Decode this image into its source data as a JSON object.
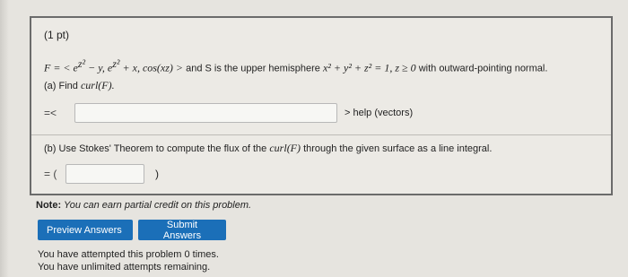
{
  "problem": {
    "points_label": "(1 pt)",
    "statement": {
      "lhs": "F = < e",
      "exp1": "z²",
      "mid1": " − y, e",
      "exp2": "z²",
      "mid2": " + x, cos(xz) >",
      "text": " and S is the upper hemisphere ",
      "eq": "x² + y² + z² = 1, z ≥ 0",
      "tail": " with outward-pointing normal."
    },
    "part_a": {
      "label": "(a) Find ",
      "math": "curl(F).",
      "prefix": "=<",
      "input_value": "",
      "help_link": "> help (vectors)"
    },
    "part_b": {
      "label": "(b) Use Stokes' Theorem to compute the flux of the ",
      "math": "curl(F)",
      "label_tail": " through the given surface as a line integral.",
      "prefix": "= (",
      "input_value": "",
      "suffix": ")"
    }
  },
  "note": {
    "bold": "Note:",
    "italic": " You can earn partial credit on this problem."
  },
  "buttons": {
    "preview": "Preview Answers",
    "submit": "Submit Answers"
  },
  "attempts": {
    "line1": "You have attempted this problem 0 times.",
    "line2": "You have unlimited attempts remaining."
  },
  "colors": {
    "button_blue": "#1b6fb8"
  }
}
